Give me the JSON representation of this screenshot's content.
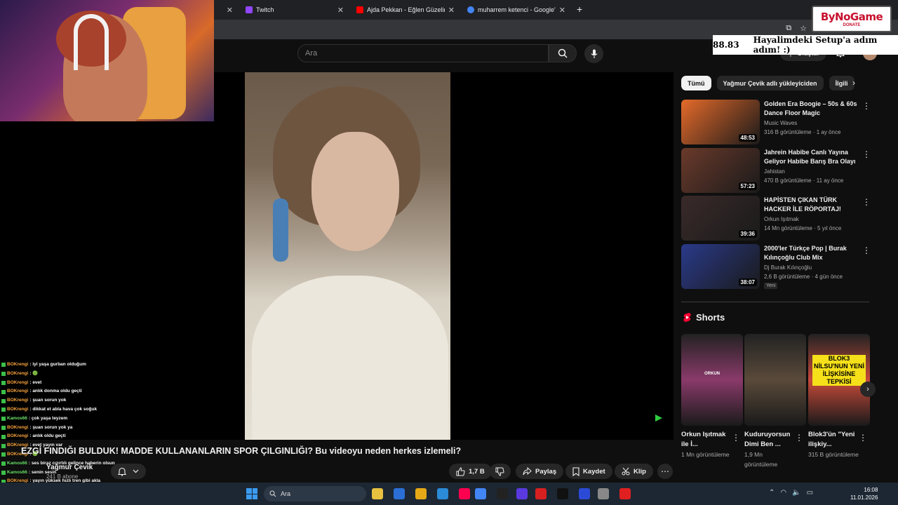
{
  "browser": {
    "tabs": [
      {
        "label": "Twitch",
        "color": "#9146ff"
      },
      {
        "label": "Ajda Pekkan - Eğlen Güzelim (C",
        "color": "#ff0000"
      },
      {
        "label": "muharrem ketenci - Google'da",
        "color": "#4285f4"
      }
    ],
    "new_tab": "+"
  },
  "overlay": {
    "banner_number": "88.83",
    "banner_text": "Hayalimdeki Setup'a adım adım! :)",
    "logo_text": "ByNoGame",
    "logo_sub": "DONATE"
  },
  "youtube": {
    "search_placeholder": "Ara",
    "create_label": "Oluştur",
    "video_title": "EZGİ FINDIĞI BULDUK! MADDE KULLANANLARIN SPOR ÇILGINLIĞI? Bu videoyu neden herkes izlemeli?",
    "channel_name": "Yağmur Çevik",
    "subscribers": "241 B abone",
    "actions": {
      "likes": "1,7 B",
      "share": "Paylaş",
      "save": "Kaydet",
      "clip": "Klip"
    },
    "chips": [
      "Tümü",
      "Yağmur Çevik adlı yükleyiciden",
      "İlgili"
    ],
    "recommendations": [
      {
        "title": "Golden Era Boogie – 50s & 60s Dance Floor Magic",
        "channel": "Music Waves",
        "meta": "316 B görüntüleme · 1 ay önce",
        "duration": "48:53",
        "thumb_color": "#e56a2a",
        "new": ""
      },
      {
        "title": "Jahrein Habibe Canlı Yayına Geliyor Habibe Barış Bra Olayı",
        "channel": "Jahistan",
        "meta": "470 B görüntüleme · 11 ay önce",
        "duration": "57:23",
        "thumb_color": "#6a3a2a",
        "new": ""
      },
      {
        "title": "HAPİSTEN ÇIKAN TÜRK HACKER İLE RÖPORTAJ!",
        "channel": "Orkun Işıtmak",
        "meta": "14 Mn görüntüleme · 5 yıl önce",
        "duration": "39:36",
        "thumb_color": "#3a2a2a",
        "new": ""
      },
      {
        "title": "2000'ler Türkçe Pop | Burak Kılınçoğlu Club Mix",
        "channel": "Dj Burak Kılınçoğlu",
        "meta": "2,6 B görüntüleme · 4 gün önce",
        "duration": "38:07",
        "thumb_color": "#2a3a8a",
        "new": "Yeni"
      }
    ],
    "shorts_title": "Shorts",
    "shorts": [
      {
        "title": "Orkun Işıtmak ile İ...",
        "views": "1 Mn görüntüleme",
        "thumb_color": "#8a3a6a",
        "caption": "ORKUN"
      },
      {
        "title": "Kuduruyorsun Dimi Ben ...",
        "views": "1,9 Mn görüntüleme",
        "thumb_color": "#5a4a3a",
        "caption": ""
      },
      {
        "title": "Blok3'ün \"Yeni ilişkiy...",
        "views": "315 B görüntüleme",
        "thumb_color": "#c84a3a",
        "caption": "BLOK3 NİLSU'NUN YENİ İLİŞKİSİNE TEPKİSİ"
      }
    ]
  },
  "chat": [
    {
      "user": "BOKrengi",
      "msg": ": iyi yaşa gurban olduğum"
    },
    {
      "user": "BOKrengi",
      "msg": ": 🟢"
    },
    {
      "user": "BOKrengi",
      "msg": ": evet"
    },
    {
      "user": "BOKrengi",
      "msg": ": anlık donma oldu geçti"
    },
    {
      "user": "BOKrengi",
      "msg": ": şuan sorun yok"
    },
    {
      "user": "BOKrengi",
      "msg": ": dikkat et abla hava çok soğuk"
    },
    {
      "user": "Kamos66",
      "msg": ": çok yaşa teyzem"
    },
    {
      "user": "BOKrengi",
      "msg": ": şuan sorun yok ya"
    },
    {
      "user": "BOKrengi",
      "msg": ": anlık oldu geçti"
    },
    {
      "user": "BOKrengi",
      "msg": ": evet yayın var"
    },
    {
      "user": "BOKrengi",
      "msg": ": 🟢"
    },
    {
      "user": "Kamos66",
      "msg": ": ses biraz cızırtılı gelince haberin olsun"
    },
    {
      "user": "Kamos66",
      "msg": ": senin sesin"
    },
    {
      "user": "BOKrengi",
      "msg": ": yayın yüksek hızlı tren gibi akla"
    }
  ],
  "taskbar": {
    "search_placeholder": "Ara",
    "time": "16:08",
    "date": "11.01.2026",
    "apps": [
      "#3a9bf0",
      "#e8c040",
      "#2b6fd6",
      "#e6a817",
      "#2b8bd6",
      "#ff0050",
      "#4285f4",
      "#222222",
      "#5a3ae0",
      "#d62020",
      "#111111",
      "#2b4ad6",
      "#888888",
      "#e02020"
    ]
  }
}
